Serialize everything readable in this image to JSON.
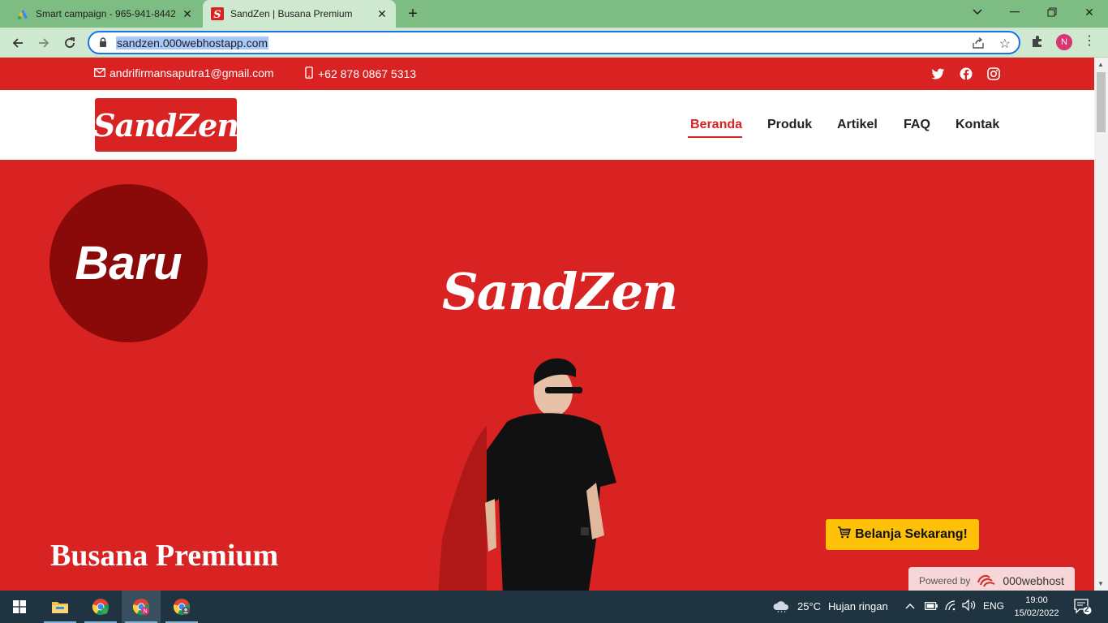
{
  "browser": {
    "tabs": [
      {
        "title": "Smart campaign - 965-941-8442",
        "icon": "google-ads-icon"
      },
      {
        "title": "SandZen | Busana Premium",
        "icon": "sandzen-favicon",
        "active": true
      }
    ],
    "url": "sandzen.000webhostapp.com",
    "profile_initial": "N"
  },
  "site": {
    "topbar": {
      "email": "andrifirmansaputra1@gmail.com",
      "phone": "+62 878 0867 5313",
      "social": [
        "twitter-icon",
        "facebook-icon",
        "instagram-icon"
      ]
    },
    "logo_text": "SandZen",
    "nav": [
      "Beranda",
      "Produk",
      "Artikel",
      "FAQ",
      "Kontak"
    ],
    "active_nav": "Beranda",
    "hero": {
      "badge": "Baru",
      "brand": "SandZen",
      "subtitle": "Busana Premium",
      "cta": "Belanja Sekarang!"
    },
    "powered": {
      "label": "Powered by",
      "brand": "000webhost"
    }
  },
  "taskbar": {
    "weather_temp": "25°C",
    "weather_text": "Hujan ringan",
    "lang": "ENG",
    "time": "19:00",
    "date": "15/02/2022",
    "notifications": "2"
  },
  "colors": {
    "brand_red": "#d92323",
    "badge_red": "#8a0a0a",
    "cta_yellow": "#ffc107",
    "chrome_green": "#7dbd84"
  }
}
